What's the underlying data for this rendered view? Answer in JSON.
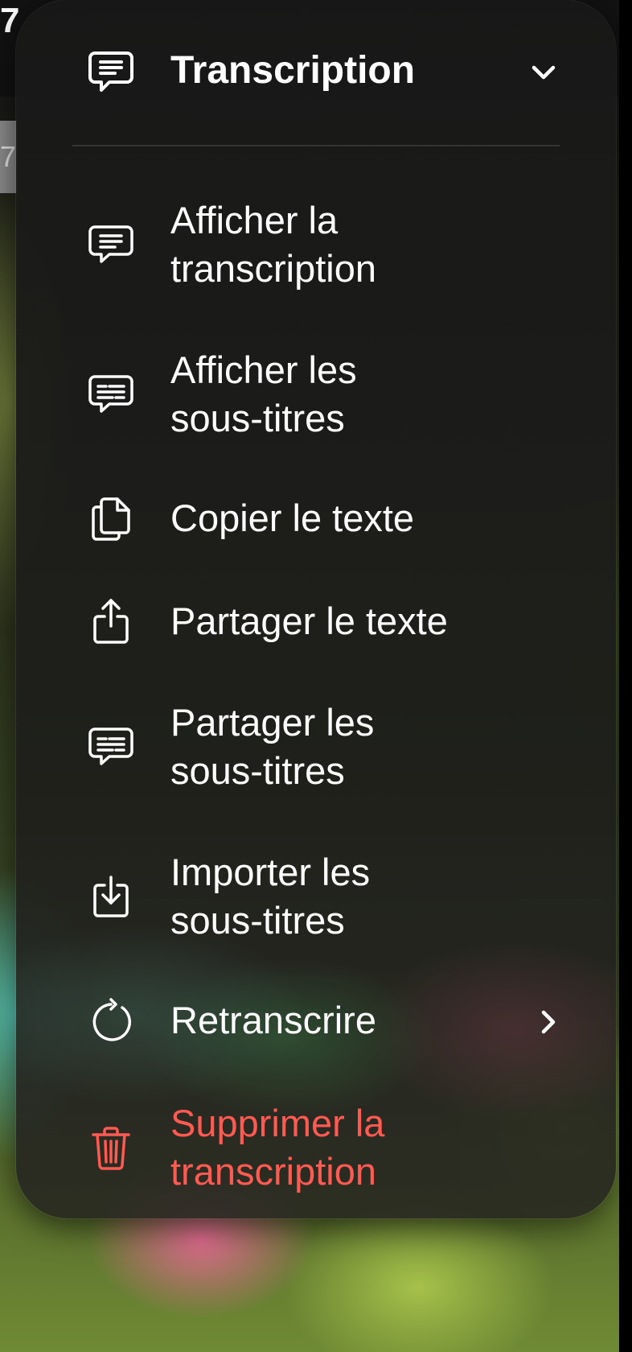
{
  "status": {
    "top_number": "7",
    "side_number": "7"
  },
  "menu": {
    "title": "Transcription",
    "header_icon": "speech-bubble-lines-icon",
    "chevron_icon": "chevron-down-icon",
    "items": [
      {
        "label": "Afficher la\ntranscription",
        "icon": "speech-bubble-lines-icon"
      },
      {
        "label": "Afficher les\nsous-titres",
        "icon": "captions-bubble-icon"
      },
      {
        "label": "Copier le texte",
        "icon": "copy-documents-icon"
      },
      {
        "label": "Partager le texte",
        "icon": "share-icon"
      },
      {
        "label": "Partager les\nsous-titres",
        "icon": "captions-bubble-icon"
      },
      {
        "label": "Importer les\nsous-titres",
        "icon": "import-tray-icon"
      },
      {
        "label": "Retranscrire",
        "icon": "refresh-icon",
        "submenu_icon": "chevron-right-icon"
      },
      {
        "label": "Supprimer la\ntranscription",
        "icon": "trash-icon",
        "destructive": true
      }
    ]
  },
  "colors": {
    "text": "#ffffff",
    "destructive": "#ff5a52"
  }
}
